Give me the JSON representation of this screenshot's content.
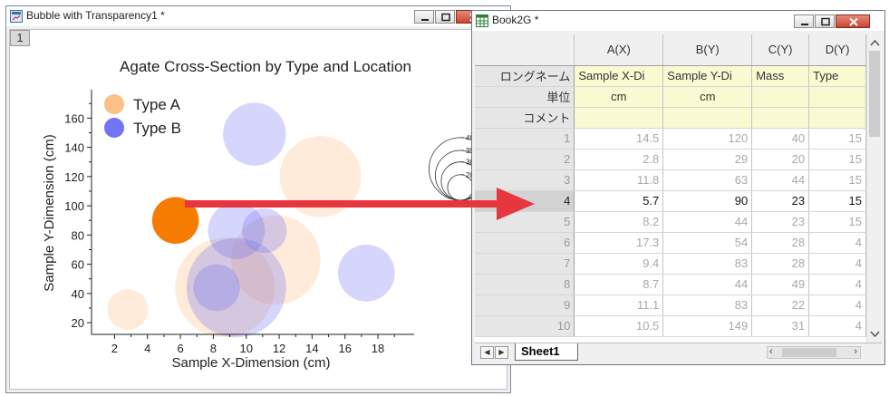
{
  "graph_window": {
    "title": "Bubble with Transparency1 *",
    "layer_badge": "1",
    "icons": {
      "window": "graph-window-icon"
    }
  },
  "chart_data": {
    "type": "scatter",
    "title": "Agate Cross-Section by Type and Location",
    "xlabel": "Sample X-Dimension (cm)",
    "ylabel": "Sample Y-Dimension (cm)",
    "xlim": [
      0.6,
      20.2
    ],
    "ylim": [
      12,
      172
    ],
    "xticks": [
      2,
      4,
      6,
      8,
      10,
      12,
      14,
      16,
      18
    ],
    "yticks": [
      20,
      40,
      60,
      80,
      100,
      120,
      140,
      160
    ],
    "legend_placement": "top-left",
    "series": [
      {
        "name": "Type A",
        "color": "#fdb877",
        "points": [
          {
            "x": 2.8,
            "y": 29,
            "size": 20
          },
          {
            "x": 8.7,
            "y": 44,
            "size": 49
          },
          {
            "x": 11.8,
            "y": 63,
            "size": 44
          },
          {
            "x": 14.5,
            "y": 120,
            "size": 40
          },
          {
            "x": 5.7,
            "y": 90,
            "size": 23
          }
        ]
      },
      {
        "name": "Type B",
        "color": "#6b6bf6",
        "points": [
          {
            "x": 10.5,
            "y": 149,
            "size": 31
          },
          {
            "x": 9.4,
            "y": 83,
            "size": 28
          },
          {
            "x": 11.1,
            "y": 83,
            "size": 22
          },
          {
            "x": 8.2,
            "y": 44,
            "size": 23
          },
          {
            "x": 17.3,
            "y": 54,
            "size": 28
          },
          {
            "x": 9.4,
            "y": 44,
            "size": 49
          }
        ]
      }
    ],
    "highlight": {
      "x": 5.7,
      "y": 90,
      "size": 23,
      "color": "#f57c00"
    },
    "size_scale": {
      "labels": [
        49,
        39,
        30,
        20
      ]
    },
    "arrow_color": "#e8363e"
  },
  "sheet_window": {
    "title": "Book2G *",
    "icons": {
      "window": "workbook-icon"
    },
    "columns": [
      {
        "header": "A(X)",
        "long_name": "Sample X-Di",
        "units": "cm",
        "comment": ""
      },
      {
        "header": "B(Y)",
        "long_name": "Sample Y-Di",
        "units": "cm",
        "comment": ""
      },
      {
        "header": "C(Y)",
        "long_name": "Mass",
        "units": "",
        "comment": ""
      },
      {
        "header": "D(Y)",
        "long_name": "Type",
        "units": "",
        "comment": ""
      }
    ],
    "row_labels": {
      "long_name": "ロングネーム",
      "units": "単位",
      "comment": "コメント"
    },
    "rows": [
      {
        "n": "1",
        "cells": [
          "14.5",
          "120",
          "40",
          "15"
        ]
      },
      {
        "n": "2",
        "cells": [
          "2.8",
          "29",
          "20",
          "15"
        ]
      },
      {
        "n": "3",
        "cells": [
          "11.8",
          "63",
          "44",
          "15"
        ]
      },
      {
        "n": "4",
        "cells": [
          "5.7",
          "90",
          "23",
          "15"
        ]
      },
      {
        "n": "5",
        "cells": [
          "8.2",
          "44",
          "23",
          "15"
        ]
      },
      {
        "n": "6",
        "cells": [
          "17.3",
          "54",
          "28",
          "4"
        ]
      },
      {
        "n": "7",
        "cells": [
          "9.4",
          "83",
          "28",
          "4"
        ]
      },
      {
        "n": "8",
        "cells": [
          "8.7",
          "44",
          "49",
          "4"
        ]
      },
      {
        "n": "9",
        "cells": [
          "11.1",
          "83",
          "22",
          "4"
        ]
      },
      {
        "n": "10",
        "cells": [
          "10.5",
          "149",
          "31",
          "4"
        ]
      }
    ],
    "current_row": "4",
    "sheet_tab": "Sheet1"
  }
}
